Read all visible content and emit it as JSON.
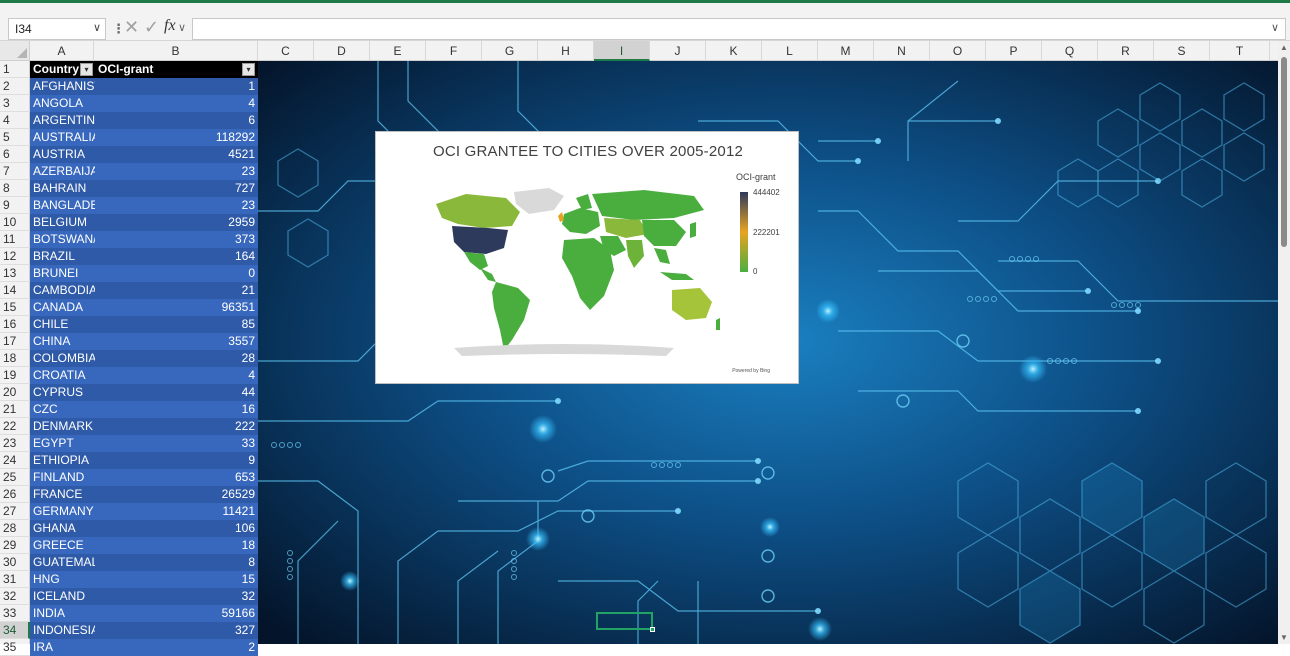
{
  "formula_bar": {
    "name_box": "I34",
    "name_box_arrow": "∨",
    "separator": "⋮",
    "cancel": "✕",
    "enter": "✓",
    "fx": "fx",
    "fx_arrow": "∨",
    "formula_value": "",
    "expand_arrow": "∨"
  },
  "columns": [
    "A",
    "B",
    "C",
    "D",
    "E",
    "F",
    "G",
    "H",
    "I",
    "J",
    "K",
    "L",
    "M",
    "N",
    "O",
    "P",
    "Q",
    "R",
    "S",
    "T"
  ],
  "selected_column": "I",
  "selected_row": "34",
  "rows": [
    "1",
    "2",
    "3",
    "4",
    "5",
    "6",
    "7",
    "8",
    "9",
    "10",
    "11",
    "12",
    "13",
    "14",
    "15",
    "16",
    "17",
    "18",
    "19",
    "20",
    "21",
    "22",
    "23",
    "24",
    "25",
    "26",
    "27",
    "28",
    "29",
    "30",
    "31",
    "32",
    "33",
    "34",
    "35"
  ],
  "table": {
    "header_country": "Country",
    "header_grant": "OCI-grant",
    "filter_icon": "▾",
    "records": [
      {
        "country": "AFGHANIST",
        "grant": "1"
      },
      {
        "country": "ANGOLA",
        "grant": "4"
      },
      {
        "country": "ARGENTIN/",
        "grant": "6"
      },
      {
        "country": "AUSTRALIA",
        "grant": "118292"
      },
      {
        "country": "AUSTRIA",
        "grant": "4521"
      },
      {
        "country": "AZERBAIJAI",
        "grant": "23"
      },
      {
        "country": "BAHRAIN",
        "grant": "727"
      },
      {
        "country": "BANGLADE:",
        "grant": "23"
      },
      {
        "country": "BELGIUM",
        "grant": "2959"
      },
      {
        "country": "BOTSWAN/",
        "grant": "373"
      },
      {
        "country": "BRAZIL",
        "grant": "164"
      },
      {
        "country": "BRUNEI",
        "grant": "0"
      },
      {
        "country": "CAMBODIA",
        "grant": "21"
      },
      {
        "country": "CANADA",
        "grant": "96351"
      },
      {
        "country": "CHILE",
        "grant": "85"
      },
      {
        "country": "CHINA",
        "grant": "3557"
      },
      {
        "country": "COLOMBIA",
        "grant": "28"
      },
      {
        "country": "CROATIA",
        "grant": "4"
      },
      {
        "country": "CYPRUS",
        "grant": "44"
      },
      {
        "country": "CZC",
        "grant": "16"
      },
      {
        "country": "DENMARK",
        "grant": "222"
      },
      {
        "country": "EGYPT",
        "grant": "33"
      },
      {
        "country": "ETHIOPIA",
        "grant": "9"
      },
      {
        "country": "FINLAND",
        "grant": "653"
      },
      {
        "country": "FRANCE",
        "grant": "26529"
      },
      {
        "country": "GERMANY",
        "grant": "11421"
      },
      {
        "country": "GHANA",
        "grant": "106"
      },
      {
        "country": "GREECE",
        "grant": "18"
      },
      {
        "country": "GUATEMAL",
        "grant": "8"
      },
      {
        "country": "HNG",
        "grant": "15"
      },
      {
        "country": "ICELAND",
        "grant": "32"
      },
      {
        "country": "INDIA",
        "grant": "59166"
      },
      {
        "country": "INDONESIA",
        "grant": "327"
      },
      {
        "country": "IRA",
        "grant": "2"
      }
    ]
  },
  "chart": {
    "title": "OCI GRANTEE TO CITIES OVER 2005-2012",
    "legend_title": "OCI-grant",
    "legend_max": "444402",
    "legend_mid": "222201",
    "legend_min": "0",
    "powered_by": "Powered by Bing",
    "colors": {
      "high": "#2d3a5c",
      "mid": "#e8a321",
      "low": "#4aae3f",
      "none": "#d9d9d9"
    }
  },
  "scrollbar": {
    "up": "▲",
    "down": "▼"
  },
  "colors": {
    "accent": "#1e7a46",
    "table_odd": "#2f5aa8",
    "table_even": "#3868bd"
  }
}
